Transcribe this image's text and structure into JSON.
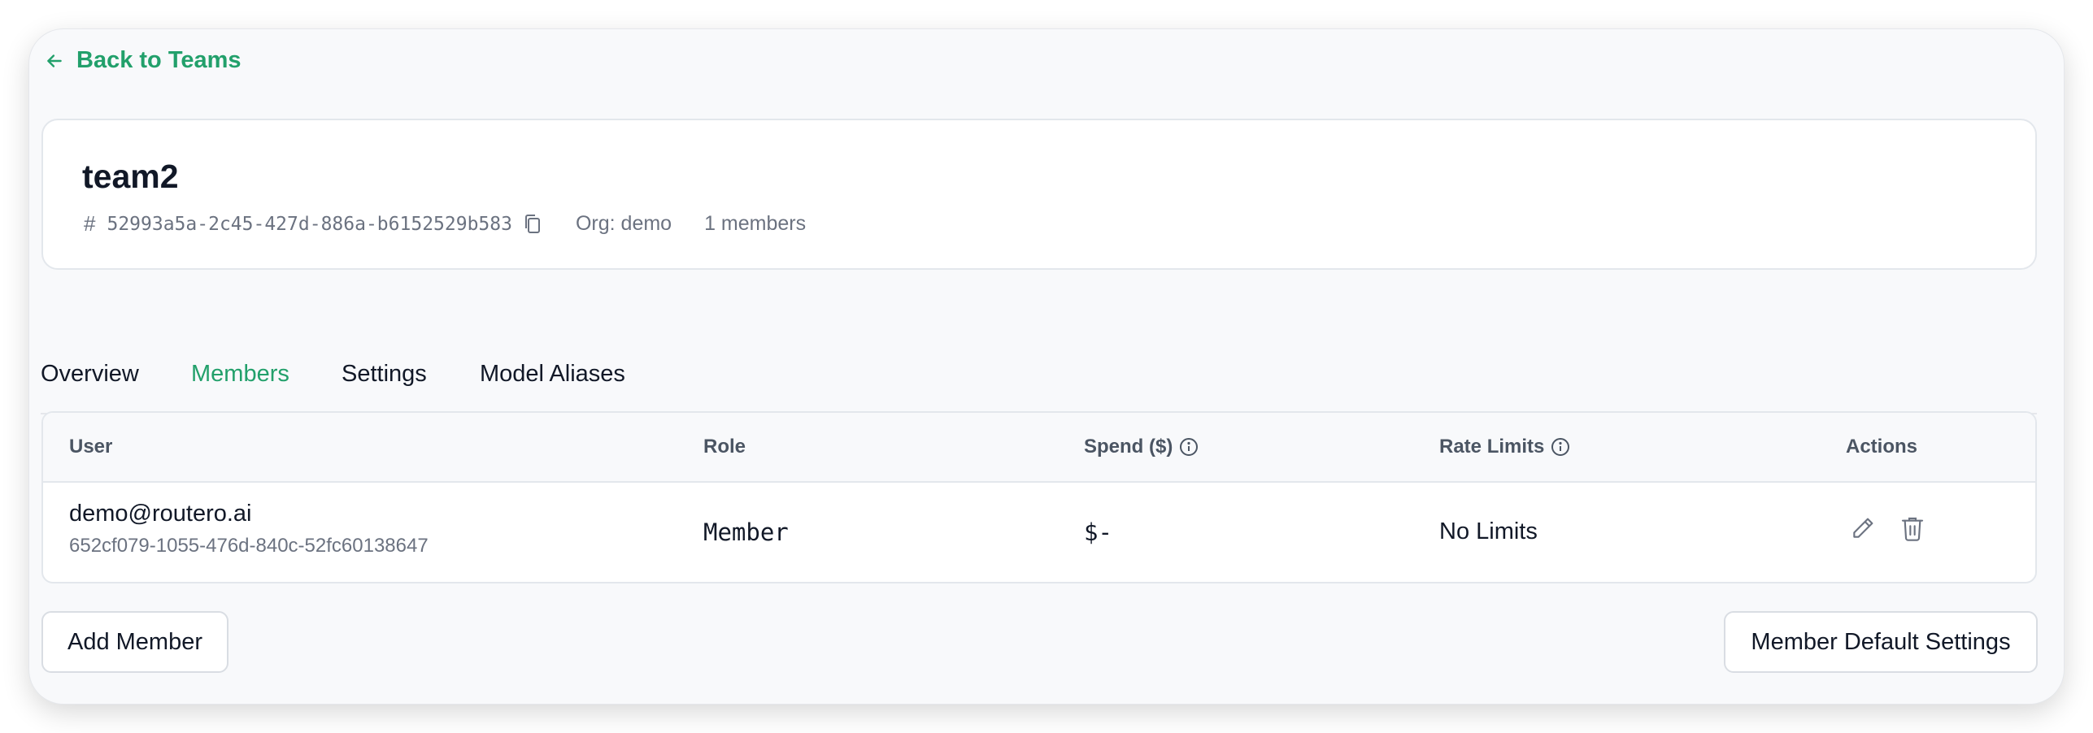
{
  "nav": {
    "back_label": "Back to Teams"
  },
  "team": {
    "name": "team2",
    "id": "52993a5a-2c45-427d-886a-b6152529b583",
    "org_label": "Org: demo",
    "members_count_label": "1 members"
  },
  "tabs": [
    {
      "label": "Overview",
      "active": false
    },
    {
      "label": "Members",
      "active": true
    },
    {
      "label": "Settings",
      "active": false
    },
    {
      "label": "Model Aliases",
      "active": false
    }
  ],
  "members_table": {
    "columns": [
      "User",
      "Role",
      "Spend ($)",
      "Rate Limits",
      "Actions"
    ],
    "rows": [
      {
        "email": "demo@routero.ai",
        "user_id": "652cf079-1055-476d-840c-52fc60138647",
        "role": "Member",
        "spend": "$-",
        "rate_limits": "No Limits"
      }
    ]
  },
  "buttons": {
    "add_member": "Add Member",
    "member_default_settings": "Member Default Settings"
  },
  "colors": {
    "accent": "#22a06b",
    "muted_text": "#6b7280",
    "border": "#e3e7ec"
  }
}
